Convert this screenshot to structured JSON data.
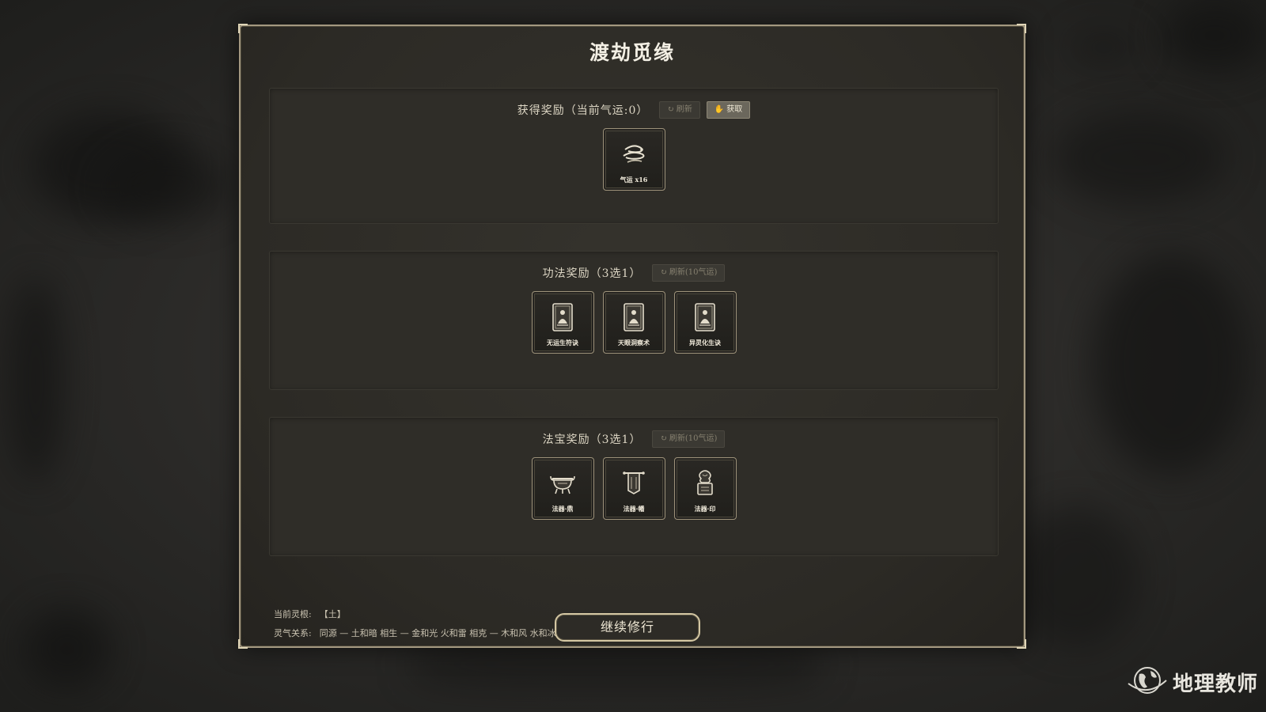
{
  "dialog": {
    "title": "渡劫觅缘",
    "sections": {
      "reward": {
        "title": "获得奖励（当前气运:0）",
        "refresh_label": "刷新",
        "claim_label": "获取",
        "cards": [
          {
            "label": "气运 x16",
            "icon": "cloud-luck-icon"
          }
        ]
      },
      "technique": {
        "title": "功法奖励（3选1）",
        "refresh_label": "刷新(10气运)",
        "cards": [
          {
            "label": "无运生符诀",
            "icon": "scripture-book-icon"
          },
          {
            "label": "天眼洞察术",
            "icon": "scripture-book-icon"
          },
          {
            "label": "异灵化生诀",
            "icon": "scripture-book-icon"
          }
        ]
      },
      "treasure": {
        "title": "法宝奖励（3选1）",
        "refresh_label": "刷新(10气运)",
        "cards": [
          {
            "label": "法器·鼎",
            "icon": "cauldron-icon"
          },
          {
            "label": "法器·幡",
            "icon": "banner-icon"
          },
          {
            "label": "法器·印",
            "icon": "seal-icon"
          }
        ]
      }
    },
    "footer": {
      "root_label": "当前灵根:",
      "root_value": "【土】",
      "relation_label": "灵气关系:",
      "relation_value": "同源 — 土和暗  相生 — 金和光 火和雷  相克 — 木和风 水和冰",
      "continue_label": "继续修行"
    }
  },
  "watermark": {
    "text": "地理教师"
  },
  "colors": {
    "accent": "#d4c7a3",
    "panel": "#2c2a25",
    "text": "#ddd6c4"
  }
}
